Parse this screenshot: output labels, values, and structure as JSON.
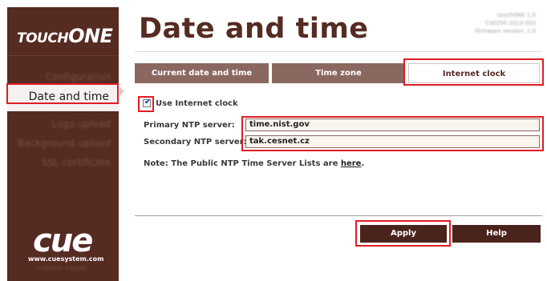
{
  "app": {
    "logo_touch": "TOUCH",
    "logo_one": "ONE",
    "version_lines": [
      "touchONE 1.0",
      "CS0250 2013-003",
      "Firmware version: 1.0"
    ]
  },
  "sidebar": {
    "items": [
      {
        "label": "Configuration"
      },
      {
        "label": "Date and time"
      },
      {
        "label": "Logo upload"
      },
      {
        "label": "Background upload"
      },
      {
        "label": "SSL certificate"
      }
    ],
    "brand": "cue",
    "brand_url": "www.cuesystem.com",
    "brand_sub": "Customer support"
  },
  "main": {
    "title": "Date and time",
    "tabs": [
      {
        "label": "Current date and time"
      },
      {
        "label": "Time zone"
      },
      {
        "label": "Internet clock"
      }
    ],
    "use_internet_clock": {
      "label": "Use Internet clock",
      "checked": true
    },
    "primary_ntp": {
      "label": "Primary NTP server:",
      "value": "time.nist.gov"
    },
    "secondary_ntp": {
      "label": "Secondary NTP server:",
      "value": "tak.cesnet.cz"
    },
    "note_prefix": "Note: The Public NTP Time Server Lists are ",
    "note_link": "here",
    "note_suffix": ".",
    "buttons": {
      "apply": "Apply",
      "help": "Help"
    }
  },
  "colors": {
    "sidebar_bg": "#552b22",
    "accent": "#552b22",
    "tab_bg": "#8a6860",
    "button_bg": "#4a231c",
    "highlight": "#e01d24"
  }
}
